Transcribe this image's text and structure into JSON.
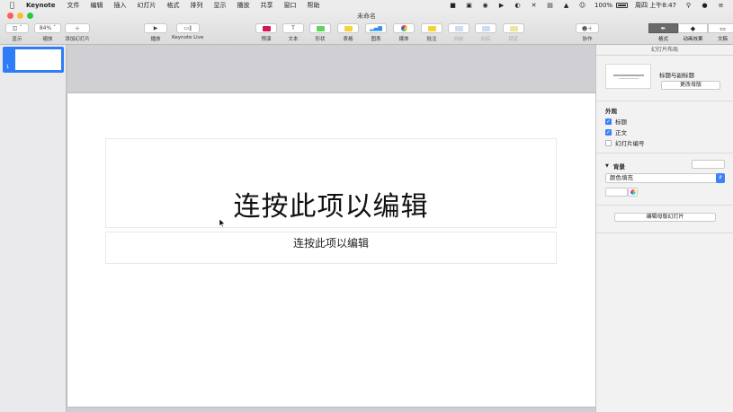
{
  "menubar": {
    "app_name": "Keynote",
    "items": [
      "文件",
      "编辑",
      "插入",
      "幻灯片",
      "格式",
      "排列",
      "显示",
      "播放",
      "共享",
      "窗口",
      "帮助"
    ],
    "battery": "100%",
    "clock": "周四 上午8:47"
  },
  "window": {
    "title": "未命名"
  },
  "toolbar": {
    "view_label": "显示",
    "zoom_value": "84%",
    "zoom_label": "缩放",
    "add_slide_label": "添加幻灯片",
    "play_label": "播放",
    "keynote_live_label": "Keynote Live",
    "preview_label": "预演",
    "text_label": "文本",
    "shape_label": "形状",
    "table_label": "表格",
    "chart_label": "图表",
    "media_label": "媒体",
    "comment_label": "批注",
    "forward_label": "向前",
    "backward_label": "向后",
    "lock_label": "锁定",
    "collaborate_label": "协作",
    "format_label": "格式",
    "animate_label": "动画效果",
    "document_label": "文稿"
  },
  "navigator": {
    "slide_number": "1"
  },
  "slide": {
    "title_placeholder": "连按此项以编辑",
    "subtitle_placeholder": "连按此项以编辑"
  },
  "inspector": {
    "header": "幻灯片布局",
    "master_name": "标题与副标题",
    "change_master_button": "更改母版",
    "appearance_title": "外观",
    "checkbox_title": {
      "label": "标题",
      "checked": true
    },
    "checkbox_body": {
      "label": "正文",
      "checked": true
    },
    "checkbox_slide_number": {
      "label": "幻灯片编号",
      "checked": false
    },
    "background_title": "背景",
    "fill_type": "颜色填充",
    "edit_master_button": "编辑母版幻灯片"
  },
  "colors": {
    "accent_blue": "#3b82f6",
    "thumb_selected": "#2e7cf6",
    "close": "#fc5f57",
    "minimize": "#fdbc2e",
    "maximize": "#28c840"
  }
}
